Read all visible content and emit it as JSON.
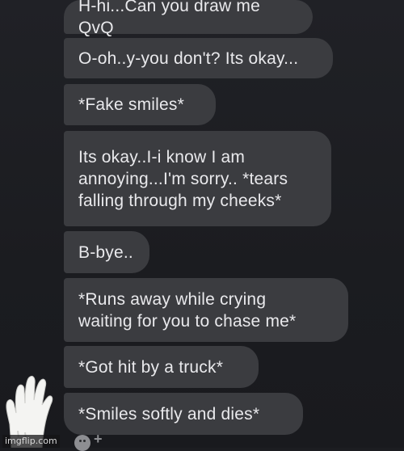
{
  "messages": [
    {
      "text": "H-hi...Can you draw me QvQ"
    },
    {
      "text": "O-oh..y-you don't? Its okay..."
    },
    {
      "text": "*Fake smiles*"
    },
    {
      "text": "Its okay..I-i know I am\nannoying...I'm sorry.. *tears\nfalling through my cheeks*"
    },
    {
      "text": "B-bye.."
    },
    {
      "text": "*Runs away while crying\nwaiting for you to chase me*"
    },
    {
      "text": "*Got hit by a truck*"
    },
    {
      "text": "*Smiles softly and dies*"
    }
  ],
  "composer": {
    "emoji_icon": "smiley-face-icon",
    "plus_label": "+"
  },
  "overlay": {
    "hand_icon": "waving-hand-icon"
  },
  "watermark": {
    "text": "imgflip.com"
  },
  "colors": {
    "background": "#1c1d21",
    "bubble": "#3b3c40",
    "text": "#e9e9ec"
  }
}
